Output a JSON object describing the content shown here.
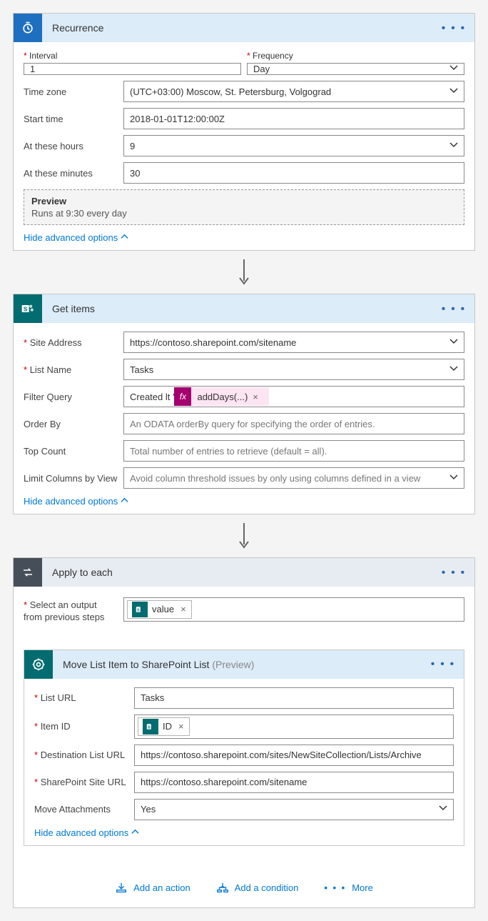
{
  "recurrence": {
    "title": "Recurrence",
    "interval_label": "Interval",
    "interval_value": "1",
    "frequency_label": "Frequency",
    "frequency_value": "Day",
    "timezone_label": "Time zone",
    "timezone_value": "(UTC+03:00) Moscow, St. Petersburg, Volgograd",
    "starttime_label": "Start time",
    "starttime_value": "2018-01-01T12:00:00Z",
    "athours_label": "At these hours",
    "athours_value": "9",
    "atminutes_label": "At these minutes",
    "atminutes_value": "30",
    "preview_title": "Preview",
    "preview_text": "Runs at 9:30 every day",
    "hide_link": "Hide advanced options"
  },
  "getitems": {
    "title": "Get items",
    "siteaddr_label": "Site Address",
    "siteaddr_value": "https://contoso.sharepoint.com/sitename",
    "listname_label": "List Name",
    "listname_value": "Tasks",
    "filter_label": "Filter Query",
    "filter_prefix": "Created lt '",
    "filter_expr": "addDays(...)",
    "orderby_label": "Order By",
    "orderby_placeholder": "An ODATA orderBy query for specifying the order of entries.",
    "topcount_label": "Top Count",
    "topcount_placeholder": "Total number of entries to retrieve (default = all).",
    "limitcols_label": "Limit Columns by View",
    "limitcols_placeholder": "Avoid column threshold issues by only using columns defined in a view",
    "hide_link": "Hide advanced options"
  },
  "applyeach": {
    "title": "Apply to each",
    "select_label_1": "Select an output",
    "select_label_2": "from previous steps",
    "token_value": "value"
  },
  "moveitem": {
    "title": "Move List Item to SharePoint List",
    "title_suffix": "(Preview)",
    "listurl_label": "List URL",
    "listurl_value": "Tasks",
    "itemid_label": "Item ID",
    "itemid_token": "ID",
    "desturl_label": "Destination List URL",
    "desturl_value": "https://contoso.sharepoint.com/sites/NewSiteCollection/Lists/Archive",
    "siteurl_label": "SharePoint Site URL",
    "siteurl_value": "https://contoso.sharepoint.com/sitename",
    "moveatt_label": "Move Attachments",
    "moveatt_value": "Yes",
    "hide_link": "Hide advanced options"
  },
  "actions": {
    "add_action": "Add an action",
    "add_condition": "Add a condition",
    "more": "More"
  },
  "symbols": {
    "fx": "fx",
    "x": "×",
    "dots": "• • •"
  }
}
